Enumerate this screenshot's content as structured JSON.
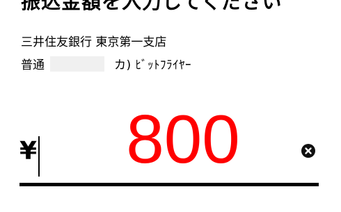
{
  "header": {
    "title": "振込金額を入力してください"
  },
  "recipient": {
    "bank_branch": "三井住友銀行 東京第一支店",
    "account_type": "普通",
    "account_holder": "カ) ﾋﾞｯﾄﾌﾗｲﾔｰ"
  },
  "amount": {
    "currency_symbol": "¥",
    "value": "800",
    "value_color": "#ff0000"
  },
  "icons": {
    "clear": "close-circle-icon"
  }
}
